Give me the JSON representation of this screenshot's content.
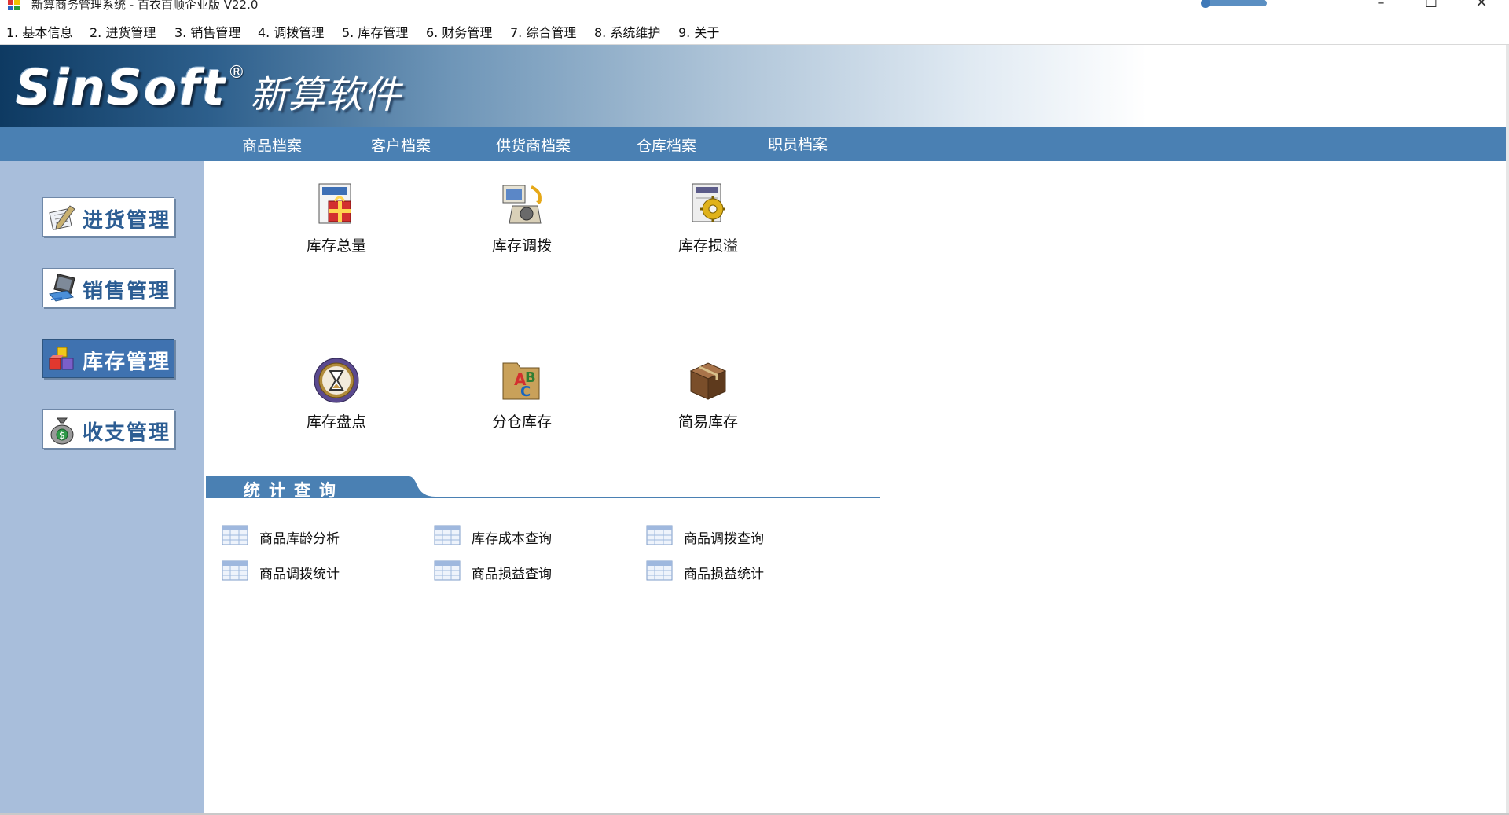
{
  "window": {
    "title": "新算商务管理系统 - 百衣百顺企业版 V22.0",
    "controls": {
      "minimize": "–",
      "maximize": "☐",
      "close": "✕"
    }
  },
  "menu": [
    {
      "label": "1. 基本信息"
    },
    {
      "label": "2. 进货管理"
    },
    {
      "label": "3. 销售管理"
    },
    {
      "label": "4. 调拨管理"
    },
    {
      "label": "5. 库存管理"
    },
    {
      "label": "6. 财务管理"
    },
    {
      "label": "7. 综合管理"
    },
    {
      "label": "8. 系统维护"
    },
    {
      "label": "9. 关于"
    }
  ],
  "brand": {
    "latin": "SinSoft",
    "reg": "®",
    "chinese": "新算软件"
  },
  "nav": [
    {
      "label": "商品档案"
    },
    {
      "label": "客户档案"
    },
    {
      "label": "供货商档案"
    },
    {
      "label": "仓库档案"
    },
    {
      "label": "职员档案"
    }
  ],
  "modules": [
    {
      "label": "进货管理",
      "icon": "purchase-icon",
      "active": false
    },
    {
      "label": "销售管理",
      "icon": "sales-icon",
      "active": false
    },
    {
      "label": "库存管理",
      "icon": "inventory-icon",
      "active": true
    },
    {
      "label": "收支管理",
      "icon": "money-bag-icon",
      "active": false
    }
  ],
  "tiles": [
    {
      "label": "库存总量",
      "icon": "stock-total-icon"
    },
    {
      "label": "库存调拨",
      "icon": "stock-transfer-icon"
    },
    {
      "label": "库存损溢",
      "icon": "stock-loss-gain-icon"
    },
    {
      "label": "库存盘点",
      "icon": "hourglass-icon"
    },
    {
      "label": "分仓库存",
      "icon": "abc-folder-icon"
    },
    {
      "label": "简易库存",
      "icon": "box-icon"
    }
  ],
  "stats": {
    "title": "统计查询",
    "queries": [
      {
        "label": "商品库龄分析"
      },
      {
        "label": "库存成本查询"
      },
      {
        "label": "商品调拨查询"
      },
      {
        "label": "商品调拨统计"
      },
      {
        "label": "商品损益查询"
      },
      {
        "label": "商品损益统计"
      }
    ]
  },
  "colors": {
    "nav_strip": "#4a80b3",
    "left_panel": "#a8bedb",
    "active_module": "#3f72b0",
    "module_label": "#2c5d93"
  }
}
